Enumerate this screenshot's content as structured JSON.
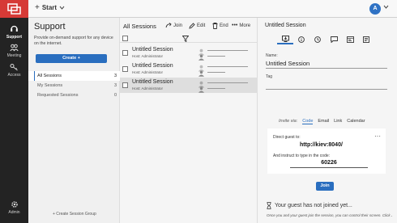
{
  "topbar": {
    "start_label": "Start",
    "avatar_initial": "A"
  },
  "leftnav": {
    "items": [
      {
        "label": "Support",
        "icon": "headset-icon"
      },
      {
        "label": "Meeting",
        "icon": "people-icon"
      },
      {
        "label": "Access",
        "icon": "key-icon"
      }
    ],
    "admin_label": "Admin"
  },
  "support": {
    "title": "Support",
    "description": "Provide on-demand support for any device on the internet.",
    "create_label": "Create",
    "filters": [
      {
        "label": "All Sessions",
        "count": "3"
      },
      {
        "label": "My Sessions",
        "count": "3"
      },
      {
        "label": "Requested Sessions",
        "count": "0"
      }
    ],
    "create_group_label": "+ Create Session Group"
  },
  "sessions": {
    "title": "All Sessions",
    "toolbar": {
      "join": "Join",
      "edit": "Edit",
      "end": "End",
      "more": "More"
    },
    "rows": [
      {
        "name": "Untitled Session",
        "host": "Host: Administrator"
      },
      {
        "name": "Untitled Session",
        "host": "Host: Administrator"
      },
      {
        "name": "Untitled Session",
        "host": "Host: Administrator"
      }
    ]
  },
  "detail": {
    "title": "Untitled Session",
    "name_label": "Name:",
    "name_value": "Untitled Session",
    "tag_label": "Tag",
    "tag_value": "",
    "invite": {
      "label": "Invite via:",
      "tabs": [
        "Code",
        "Email",
        "Link",
        "Calendar"
      ],
      "direct_text": "Direct guest to:",
      "url": "http://kiev:8040/",
      "instruct_text": "And instruct to type in the code:",
      "code": "60226"
    },
    "join_label": "Join",
    "not_joined": "Your guest has not joined yet...",
    "not_joined_sub": "Once you and your guest join the session, you can control their screen. Click Join to launch the host client."
  },
  "colors": {
    "accent": "#2a6ebf",
    "brand": "#d63a36",
    "nav_bg": "#232323"
  }
}
